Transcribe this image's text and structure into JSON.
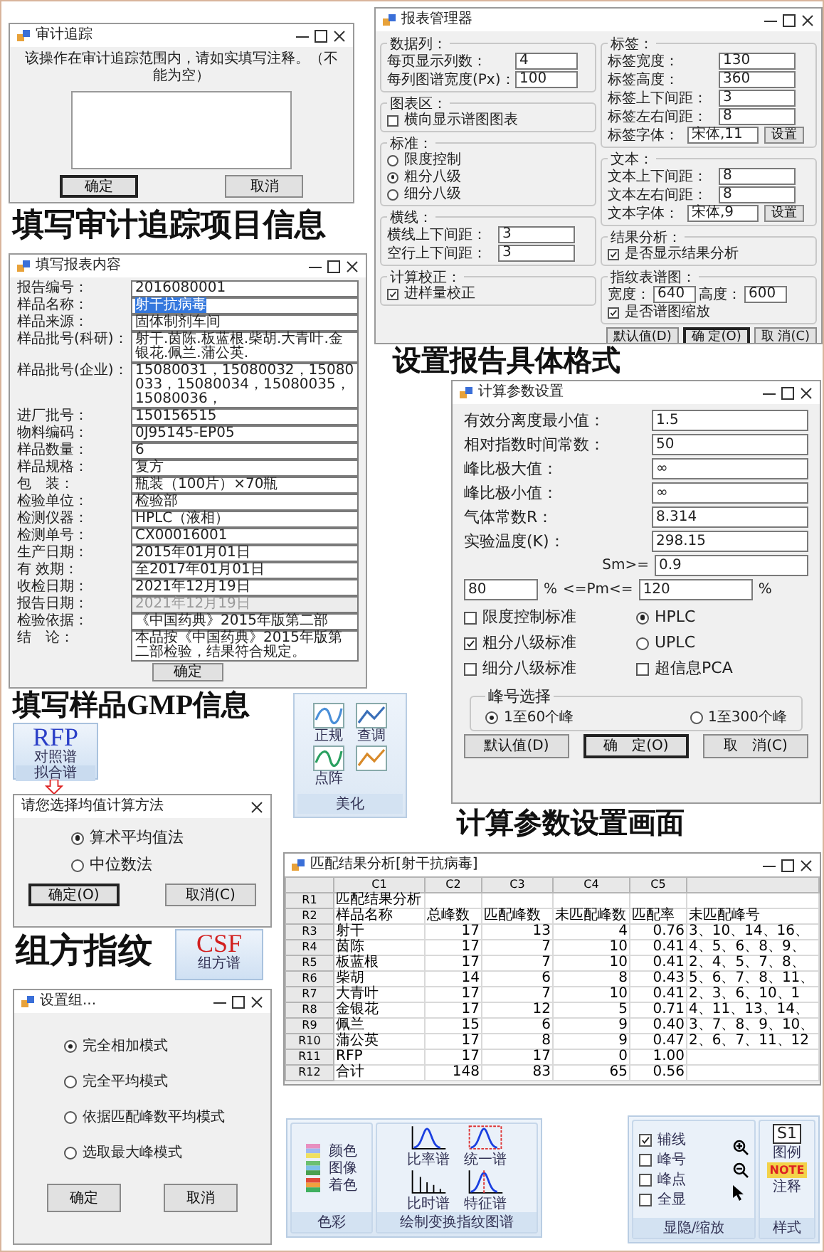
{
  "audit_window": {
    "title": "审计追踪",
    "prompt": "该操作在审计追踪范围内，请如实填写注释。（不能为空）",
    "buttons": [
      {
        "label": "确定",
        "default": true
      },
      {
        "label": "取消",
        "default": false
      }
    ]
  },
  "caption_audit": "填写审计追踪项目信息",
  "report_content_window": {
    "title": "填写报表内容",
    "fields": [
      {
        "label": "报告编号：",
        "value": "2016080001",
        "selected": false,
        "disabled": false
      },
      {
        "label": "样品名称：",
        "value": "射干抗病毒",
        "selected": true,
        "disabled": false
      },
      {
        "label": "样品来源：",
        "value": "固体制剂车间",
        "selected": false,
        "disabled": false
      },
      {
        "label": "样品批号(科研)：",
        "value": "射干.茵陈.板蓝根.柴胡.大青叶.金银花.佩兰.蒲公英.",
        "selected": false,
        "disabled": false
      },
      {
        "label": "样品批号(企业)：",
        "value": "15080031，15080032，15080033，15080034，15080035，15080036，",
        "selected": false,
        "disabled": false
      },
      {
        "label": "进厂批号：",
        "value": "150156515",
        "selected": false,
        "disabled": false
      },
      {
        "label": "物料编码：",
        "value": "0J95145-EP05",
        "selected": false,
        "disabled": false
      },
      {
        "label": "样品数量：",
        "value": "6",
        "selected": false,
        "disabled": false
      },
      {
        "label": "样品规格：",
        "value": "复方",
        "selected": false,
        "disabled": false
      },
      {
        "label": "包　装：",
        "value": "瓶装（100片）×70瓶",
        "selected": false,
        "disabled": false
      },
      {
        "label": "检验单位：",
        "value": "检验部",
        "selected": false,
        "disabled": false
      },
      {
        "label": "检测仪器：",
        "value": "HPLC（液相）",
        "selected": false,
        "disabled": false
      },
      {
        "label": "检测单号：",
        "value": "CX00016001",
        "selected": false,
        "disabled": false
      },
      {
        "label": "生产日期：",
        "value": "2015年01月01日",
        "selected": false,
        "disabled": false
      },
      {
        "label": "有 效期：",
        "value": "至2017年01月01日",
        "selected": false,
        "disabled": false
      },
      {
        "label": "收检日期：",
        "value": "2021年12月19日",
        "selected": false,
        "disabled": false
      },
      {
        "label": "报告日期：",
        "value": "2021年12月19日",
        "selected": false,
        "disabled": true
      },
      {
        "label": "检验依据：",
        "value": "《中国药典》2015年版第二部",
        "selected": false,
        "disabled": false
      },
      {
        "label": "结　论：",
        "value": "本品按《中国药典》2015年版第二部检验，结果符合规定。",
        "selected": false,
        "disabled": false
      }
    ],
    "button": "确定"
  },
  "report_manager_window": {
    "title": "报表管理器",
    "left_groups": [
      {
        "title": "数据列：",
        "rows": [
          {
            "kind": "spin",
            "label": "每页显示列数：",
            "value": "4"
          },
          {
            "kind": "spin",
            "label": "每列图谱宽度(Px)：",
            "value": "100"
          }
        ]
      },
      {
        "title": "图表区：",
        "rows": [
          {
            "kind": "check",
            "label": "横向显示谱图图表",
            "checked": false
          }
        ]
      },
      {
        "title": "标准：",
        "rows": [
          {
            "kind": "radio",
            "label": "限度控制",
            "selected": false
          },
          {
            "kind": "radio",
            "label": "粗分八级",
            "selected": true
          },
          {
            "kind": "radio",
            "label": "细分八级",
            "selected": false
          }
        ]
      },
      {
        "title": "横线：",
        "rows": [
          {
            "kind": "field",
            "label": "横线上下间距：",
            "value": "3"
          },
          {
            "kind": "field",
            "label": "空行上下间距：",
            "value": "3"
          }
        ]
      },
      {
        "title": "计算校正：",
        "rows": [
          {
            "kind": "check",
            "label": "进样量校正",
            "checked": true
          }
        ]
      }
    ],
    "right_groups": [
      {
        "title": "标签：",
        "rows": [
          {
            "kind": "field",
            "label": "标签宽度：",
            "value": "130"
          },
          {
            "kind": "field",
            "label": "标签高度：",
            "value": "360"
          },
          {
            "kind": "field",
            "label": "标签上下间距：",
            "value": "3"
          },
          {
            "kind": "field",
            "label": "标签左右间距：",
            "value": "8"
          },
          {
            "kind": "font",
            "label": "标签字体：",
            "value": "宋体,11",
            "button": "设置"
          }
        ]
      },
      {
        "title": "文本：",
        "rows": [
          {
            "kind": "field",
            "label": "文本上下间距：",
            "value": "8"
          },
          {
            "kind": "field",
            "label": "文本左右间距：",
            "value": "8"
          },
          {
            "kind": "font",
            "label": "文本字体：",
            "value": "宋体,9",
            "button": "设置"
          }
        ]
      },
      {
        "title": "结果分析：",
        "rows": [
          {
            "kind": "check",
            "label": "是否显示结果分析",
            "checked": true
          }
        ]
      },
      {
        "title": "指纹表谱图：",
        "rows": [
          {
            "kind": "pair",
            "label": "宽度：",
            "value": "640",
            "label2": "高度：",
            "value2": "600"
          },
          {
            "kind": "check",
            "label": "是否谱图缩放",
            "checked": true
          }
        ]
      }
    ],
    "buttons": [
      {
        "label": "默认值(D)",
        "default": false
      },
      {
        "label": "确 定(O)",
        "default": true
      },
      {
        "label": "取 消(C)",
        "default": false
      }
    ]
  },
  "caption_report_format": "设置报告具体格式",
  "calc_params_window": {
    "title": "计算参数设置",
    "fields": [
      {
        "label": "有效分离度最小值：",
        "value": "1.5"
      },
      {
        "label": "相对指数时间常数：",
        "value": "50"
      },
      {
        "label": "峰比极大值：",
        "value": "∞"
      },
      {
        "label": "峰比极小值：",
        "value": "∞"
      },
      {
        "label": "气体常数R：",
        "value": "8.314"
      },
      {
        "label": "实验温度(K)：",
        "value": "298.15"
      }
    ],
    "sm_label": "Sm>=",
    "sm_value": "0.9",
    "pm_low": "80",
    "pm_unit_low": "%",
    "pm_label": "<=Pm<=",
    "pm_high": "120",
    "pm_unit_high": "%",
    "options": [
      {
        "kind": "check",
        "label": "限度控制标准",
        "checked": false
      },
      {
        "kind": "radio",
        "label": "HPLC",
        "selected": true
      },
      {
        "kind": "check",
        "label": "粗分八级标准",
        "checked": true
      },
      {
        "kind": "radio",
        "label": "UPLC",
        "selected": false
      },
      {
        "kind": "check",
        "label": "细分八级标准",
        "checked": false
      },
      {
        "kind": "check",
        "label": "超信息PCA",
        "checked": false
      }
    ],
    "peak_group": {
      "title": "峰号选择",
      "options": [
        {
          "label": "1至60个峰",
          "selected": true
        },
        {
          "label": "1至300个峰",
          "selected": false
        }
      ]
    },
    "buttons": [
      {
        "label": "默认值(D)",
        "default": false
      },
      {
        "label": "确　定(O)",
        "default": true
      },
      {
        "label": "取　消(C)",
        "default": false
      }
    ]
  },
  "caption_gmp": "填写样品GMP信息",
  "beautify_ribbon": {
    "items": [
      {
        "label": "正规"
      },
      {
        "label": "查调"
      },
      {
        "label": "点阵"
      }
    ],
    "group": "美化"
  },
  "rfp_button": {
    "logo": "RFP",
    "label": "对照谱",
    "group": "拟合谱"
  },
  "mean_dialog": {
    "title": "请您选择均值计算方法",
    "options": [
      {
        "label": "算术平均值法",
        "selected": true
      },
      {
        "label": "中位数法",
        "selected": false
      }
    ],
    "buttons": [
      {
        "label": "确定(O)",
        "default": true
      },
      {
        "label": "取消(C)",
        "default": false
      }
    ]
  },
  "caption_calc": "计算参数设置画面",
  "caption_formula": "组方指纹",
  "csf_button": {
    "logo": "CSF",
    "label": "组方谱"
  },
  "group_dialog": {
    "title": "设置组...",
    "options": [
      {
        "label": "完全相加模式",
        "selected": true
      },
      {
        "label": "完全平均模式",
        "selected": false
      },
      {
        "label": "依据匹配峰数平均模式",
        "selected": false
      },
      {
        "label": "选取最大峰模式",
        "selected": false
      }
    ],
    "buttons": [
      "确定",
      "取消"
    ]
  },
  "match_window": {
    "title": "匹配结果分析[射干抗病毒]",
    "columns": [
      "C1",
      "C2",
      "C3",
      "C4",
      "C5"
    ],
    "rows": [
      {
        "header": "R1",
        "cells": [
          "匹配结果分析"
        ]
      },
      {
        "header": "R2",
        "cells": [
          "样品名称",
          "总峰数",
          "匹配峰数",
          "未匹配峰数",
          "匹配率",
          "未匹配峰号"
        ]
      },
      {
        "header": "R3",
        "cells": [
          "射干",
          "17",
          "13",
          "4",
          "0.76",
          "3、10、14、16、"
        ]
      },
      {
        "header": "R4",
        "cells": [
          "茵陈",
          "17",
          "7",
          "10",
          "0.41",
          "4、5、6、8、9、"
        ]
      },
      {
        "header": "R5",
        "cells": [
          "板蓝根",
          "17",
          "7",
          "10",
          "0.41",
          "2、4、5、7、8、"
        ]
      },
      {
        "header": "R6",
        "cells": [
          "柴胡",
          "14",
          "6",
          "8",
          "0.43",
          "5、6、7、8、11、"
        ]
      },
      {
        "header": "R7",
        "cells": [
          "大青叶",
          "17",
          "7",
          "10",
          "0.41",
          "2、3、6、10、1"
        ]
      },
      {
        "header": "R8",
        "cells": [
          "金银花",
          "17",
          "12",
          "5",
          "0.71",
          "4、11、13、14、"
        ]
      },
      {
        "header": "R9",
        "cells": [
          "佩兰",
          "15",
          "6",
          "9",
          "0.40",
          "3、7、8、9、10、"
        ]
      },
      {
        "header": "R10",
        "cells": [
          "蒲公英",
          "17",
          "8",
          "9",
          "0.47",
          "2、6、7、11、12"
        ]
      },
      {
        "header": "R11",
        "cells": [
          "RFP",
          "17",
          "17",
          "0",
          "1.00"
        ]
      },
      {
        "header": "R12",
        "cells": [
          "合计",
          "148",
          "83",
          "65",
          "0.56"
        ]
      }
    ]
  },
  "draw_ribbon": {
    "color_group": {
      "title": "色彩",
      "items": [
        "颜色",
        "图像",
        "着色"
      ]
    },
    "spectra_group": {
      "title": "绘制变换指纹图谱",
      "items": [
        {
          "kind": "ratio",
          "label": "比率谱"
        },
        {
          "kind": "unified",
          "label": "统一谱"
        },
        {
          "kind": "time",
          "label": "比时谱"
        },
        {
          "kind": "feature",
          "label": "特征谱"
        }
      ]
    }
  },
  "view_ribbon": {
    "show_group": {
      "title": "显隐/缩放",
      "checks": [
        {
          "label": "辅线",
          "checked": true
        },
        {
          "label": "峰号",
          "checked": false
        },
        {
          "label": "峰点",
          "checked": false
        },
        {
          "label": "全显",
          "checked": false
        }
      ]
    },
    "style_group": {
      "title": "样式",
      "legend_mark": "S1",
      "legend": "图例",
      "note_mark": "NOTE",
      "note": "注释"
    }
  }
}
